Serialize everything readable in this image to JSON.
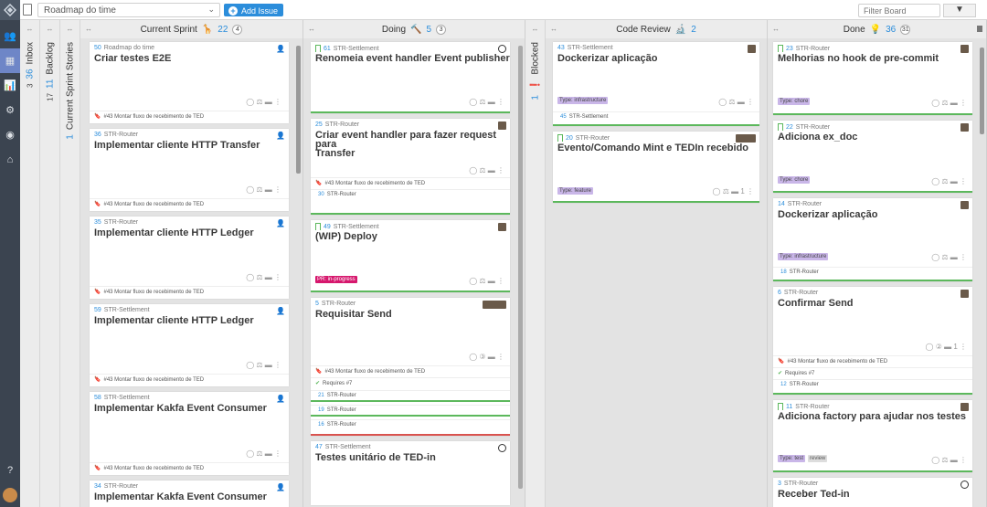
{
  "topbar": {
    "board": "Roadmap do time",
    "add_issue": "Add Issue",
    "filter_placeholder": "Filter Board"
  },
  "collapsed": [
    {
      "name": "Inbox",
      "count": "36",
      "total": "3"
    },
    {
      "name": "Backlog",
      "count": "11",
      "total": "17"
    },
    {
      "name": "Current Sprint Stories",
      "count": "1",
      "total": ""
    },
    {
      "name": "Blocked",
      "count": "1",
      "total": ""
    }
  ],
  "columns": [
    {
      "name": "Current Sprint",
      "icon": "🦒",
      "count": "22",
      "total": "4"
    },
    {
      "name": "Doing",
      "icon": "🔨",
      "count": "5",
      "total": "3"
    },
    {
      "name": "Code Review",
      "icon": "🔬",
      "count": "2",
      "total": ""
    },
    {
      "name": "Done",
      "icon": "💡",
      "count": "36",
      "total": "31"
    }
  ],
  "cards": {
    "c1": {
      "num": "50",
      "repo": "Roadmap do time",
      "title": "Criar testes E2E",
      "milestone": "#43 Montar fluxo de recebimento de TED"
    },
    "c2": {
      "num": "36",
      "repo": "STR-Router",
      "title": "Implementar cliente HTTP Transfer",
      "milestone": "#43 Montar fluxo de recebimento de TED"
    },
    "c3": {
      "num": "35",
      "repo": "STR-Router",
      "title": "Implementar cliente HTTP Ledger",
      "milestone": "#43 Montar fluxo de recebimento de TED"
    },
    "c4": {
      "num": "59",
      "repo": "STR-Settlement",
      "title": "Implementar cliente HTTP Ledger",
      "milestone": "#43 Montar fluxo de recebimento de TED"
    },
    "c5": {
      "num": "58",
      "repo": "STR-Settlement",
      "title": "Implementar Kakfa Event Consumer",
      "milestone": "#43 Montar fluxo de recebimento de TED"
    },
    "c6": {
      "num": "34",
      "repo": "STR-Router",
      "title": "Implementar Kakfa Event Consumer"
    },
    "d1": {
      "num": "61",
      "repo": "STR-Settlement",
      "title": "Renomeia event handler Event publisher"
    },
    "d2": {
      "num": "25",
      "repo": "STR-Router",
      "title1": "Criar event handler para fazer request para",
      "title2": "Transfer",
      "milestone": "#43 Montar fluxo de recebimento de TED",
      "sub_num": "30",
      "sub_repo": "STR-Router"
    },
    "d3": {
      "num": "49",
      "repo": "STR-Settlement",
      "title": "(WIP) Deploy",
      "label": "PR: in-progress"
    },
    "d4": {
      "num": "5",
      "repo": "STR-Router",
      "title": "Requisitar Send",
      "milestone": "#43 Montar fluxo de recebimento de TED",
      "requires": "Requires #7",
      "s1n": "21",
      "s1r": "STR-Router",
      "s2n": "19",
      "s2r": "STR-Router",
      "s3n": "16",
      "s3r": "STR-Router"
    },
    "d5": {
      "num": "47",
      "repo": "STR-Settlement",
      "title": "Testes unitário de TED-in"
    },
    "r1": {
      "num": "43",
      "repo": "STR-Settlement",
      "title": "Dockerizar aplicação",
      "label": "Type: infrastructure",
      "sub_num": "45",
      "sub_repo": "STR-Settlement"
    },
    "r2": {
      "num": "20",
      "repo": "STR-Router",
      "title": "Evento/Comando Mint e TEDIn recebido",
      "label": "Type: feature",
      "comments": "1"
    },
    "e1": {
      "num": "23",
      "repo": "STR-Router",
      "title": "Melhorias no hook de pre-commit",
      "label": "Type: chore"
    },
    "e2": {
      "num": "22",
      "repo": "STR-Router",
      "title": "Adiciona ex_doc",
      "label": "Type: chore"
    },
    "e3": {
      "num": "14",
      "repo": "STR-Router",
      "title": "Dockerizar aplicação",
      "label": "Type: infrastructure",
      "sub_num": "18",
      "sub_repo": "STR-Router"
    },
    "e4": {
      "num": "6",
      "repo": "STR-Router",
      "title": "Confirmar Send",
      "milestone": "#43 Montar fluxo de recebimento de TED",
      "requires": "Requires #7",
      "sub_num": "12",
      "sub_repo": "STR-Router",
      "comments": "1"
    },
    "e5": {
      "num": "11",
      "repo": "STR-Router",
      "title": "Adiciona factory para ajudar nos testes",
      "label": "Type: test",
      "label2": "review"
    },
    "e6": {
      "num": "3",
      "repo": "STR-Router",
      "title": "Receber Ted-in"
    }
  }
}
